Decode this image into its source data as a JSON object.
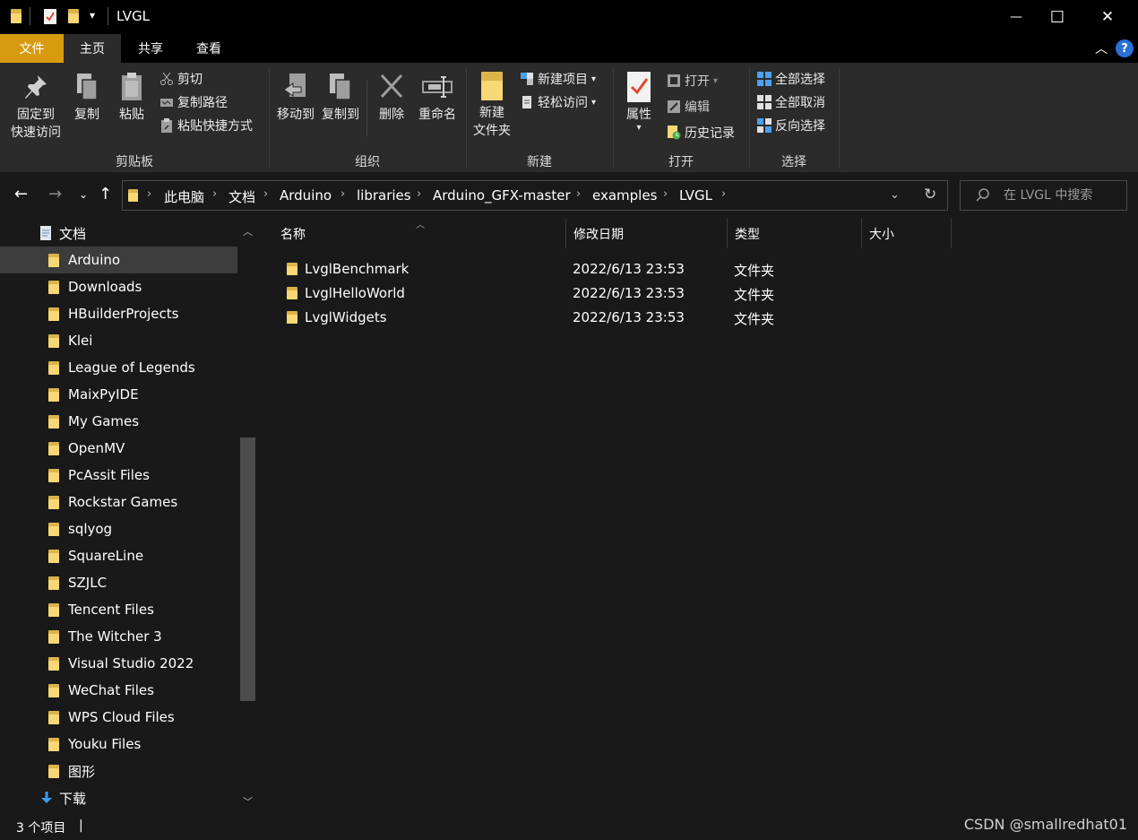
{
  "window": {
    "title": "LVGL",
    "minimize_symbol": "—",
    "maximize_symbol": "☐",
    "close_symbol": "✕",
    "qa_dropdown_symbol": "▾"
  },
  "ribbon_tabs": {
    "file": "文件",
    "home": "主页",
    "share": "共享",
    "view": "查看",
    "collapse_symbol": "︿",
    "help_symbol": "?"
  },
  "ribbon": {
    "clipboard": {
      "label": "剪贴板",
      "pin_line1": "固定到",
      "pin_line2": "快速访问",
      "copy": "复制",
      "paste": "粘贴",
      "cut": "剪切",
      "copy_path": "复制路径",
      "paste_shortcut": "粘贴快捷方式"
    },
    "organize": {
      "label": "组织",
      "move_to": "移动到",
      "copy_to": "复制到",
      "delete": "删除",
      "rename": "重命名"
    },
    "new": {
      "label": "新建",
      "new_folder_line1": "新建",
      "new_folder_line2": "文件夹",
      "new_item": "新建项目",
      "easy_access": "轻松访问"
    },
    "open": {
      "label": "打开",
      "properties": "属性",
      "open": "打开",
      "edit": "编辑",
      "history": "历史记录"
    },
    "select": {
      "label": "选择",
      "select_all": "全部选择",
      "select_none": "全部取消",
      "invert": "反向选择"
    }
  },
  "address": {
    "crumbs": [
      "此电脑",
      "文档",
      "Arduino",
      "libraries",
      "Arduino_GFX-master",
      "examples",
      "LVGL"
    ],
    "separator": "›",
    "search_placeholder": "在 LVGL 中搜索"
  },
  "nav": {
    "parent": "文档",
    "items": [
      "Arduino",
      "Downloads",
      "HBuilderProjects",
      "Klei",
      "League of Legends",
      "MaixPyIDE",
      "My Games",
      "OpenMV",
      "PcAssit Files",
      "Rockstar Games",
      "sqlyog",
      "SquareLine",
      "SZJLC",
      "Tencent Files",
      "The Witcher 3",
      "Visual Studio 2022",
      "WeChat Files",
      "WPS Cloud Files",
      "Youku Files",
      "图形"
    ],
    "downloads": "下载"
  },
  "columns": {
    "name": "名称",
    "date": "修改日期",
    "type": "类型",
    "size": "大小"
  },
  "files": [
    {
      "name": "LvglBenchmark",
      "date": "2022/6/13 23:53",
      "type": "文件夹"
    },
    {
      "name": "LvglHelloWorld",
      "date": "2022/6/13 23:53",
      "type": "文件夹"
    },
    {
      "name": "LvglWidgets",
      "date": "2022/6/13 23:53",
      "type": "文件夹"
    }
  ],
  "status": {
    "count": "3 个项目",
    "divider": "|",
    "watermark": "CSDN @smallredhat01"
  },
  "colors": {
    "file_tab": "#d79b12",
    "folder": "#f8d775",
    "accent_blue": "#2a6fd6"
  }
}
